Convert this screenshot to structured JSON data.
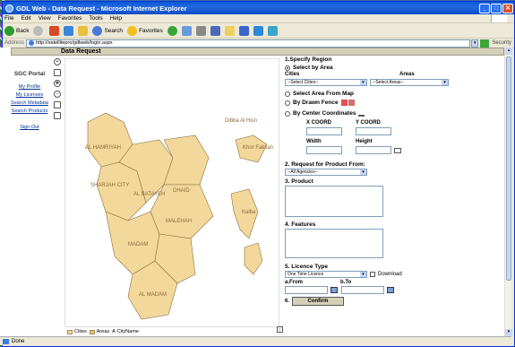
{
  "window": {
    "title": "GDL Web - Data Request - Microsoft Internet Explorer"
  },
  "menu": [
    "File",
    "Edit",
    "View",
    "Favorites",
    "Tools",
    "Help"
  ],
  "toolbar": {
    "back": "Back",
    "search": "Search",
    "favorites": "Favorites"
  },
  "address": {
    "label": "Address",
    "url": "http://satellitepro/gdlweb/login.aspx",
    "security": "Security"
  },
  "status": {
    "text": "Done"
  },
  "page": {
    "header": "Data Request"
  },
  "portal": {
    "title": "SGC Portal",
    "links": [
      "My Profile",
      "My Licenses",
      "Search Metadata",
      "Search Products",
      "Sign Out"
    ]
  },
  "map": {
    "labels": [
      "Dibba Al Hisn",
      "AL HAMRIYAH",
      "SHARJAH CITY",
      "AL BATAYEH",
      "DHAID",
      "MALEHAH",
      "MADAM",
      "AL MADAM",
      "Kalba",
      "Khor Fakkan"
    ],
    "legend": [
      "Cities",
      "Areas",
      "CityName"
    ]
  },
  "form": {
    "s1_title": "1.Specify Region",
    "opt_area": "Select by Area",
    "cities_label": "Cities",
    "areas_label": "Areas",
    "cities_value": "--Select Cities--",
    "areas_value": "--Select Areas--",
    "opt_map": "Select Area From Map",
    "opt_fence": "By Drawn Fence",
    "opt_center": "By Center Coordinates",
    "xcoord": "X COORD",
    "ycoord": "Y COORD",
    "width": "Width",
    "height": "Height",
    "s2_title": "2. Request for Product From:",
    "agencies_value": "--All Agencies--",
    "s3_title": "3. Product",
    "s4_title": "4. Features",
    "s5_title": "5. Licence Type",
    "licence_value": "One Time Licence",
    "download_label": "Download",
    "from_label": "a.From",
    "to_label": "b.To",
    "s6_label": "6.",
    "confirm_label": "Confirm"
  }
}
